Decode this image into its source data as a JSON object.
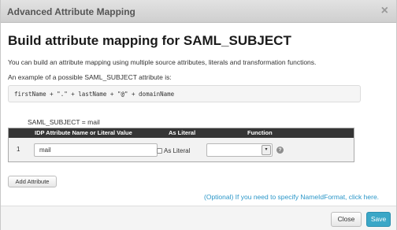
{
  "modal": {
    "title": "Advanced Attribute Mapping",
    "close_icon": "close-icon"
  },
  "main": {
    "heading": "Build attribute mapping for SAML_SUBJECT",
    "description": "You can build an attribute mapping using multiple source attributes, literals and transformation functions.",
    "example_intro": "An example of a possible SAML_SUBJECT attribute is:",
    "example_code": "firstName + \".\" + lastName + \"@\" + domainName",
    "subject_mapping": "SAML_SUBJECT = mail"
  },
  "table": {
    "headers": {
      "attribute": "IDP Attribute Name or Literal Value",
      "literal": "As Literal",
      "function": "Function"
    },
    "rows": [
      {
        "index": "1",
        "attribute_value": "mail",
        "as_literal_checked": false,
        "as_literal_label": "As Literal",
        "function_value": ""
      }
    ],
    "help_icon": "help-icon"
  },
  "actions": {
    "add_attribute": "Add Attribute",
    "nameid_link": "(Optional) If you need to specify NameIdFormat, click here."
  },
  "footer": {
    "close_label": "Close",
    "save_label": "Save"
  },
  "colors": {
    "header_dark": "#353535",
    "accent": "#3aa7c7",
    "link": "#2a96c8"
  }
}
